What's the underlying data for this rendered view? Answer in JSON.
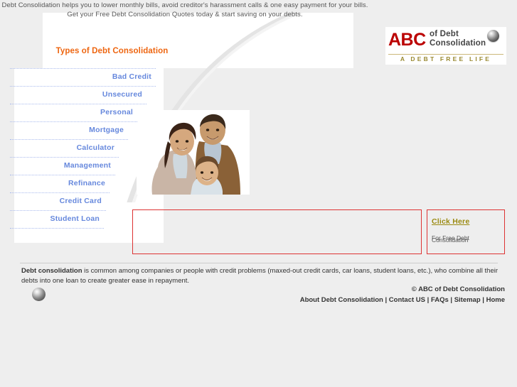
{
  "tagline": {
    "line1": "Debt Consolidation helps you to lower monthly bills, avoid creditor's harassment calls & one easy payment for your bills.",
    "line2": "Get your Free Debt Consolidation Quotes today & start saving on your debts."
  },
  "logo": {
    "abc": "ABC",
    "words_line1": "of Debt",
    "words_line2": "Consolidation",
    "tagline": "A DEBT FREE LIFE",
    "orb_icon": "sphere-orb-icon",
    "colors": {
      "abc_red": "#bb0000",
      "words_gray": "#444444",
      "tagline_olive": "#9a8a33"
    }
  },
  "sidebar": {
    "heading": "Types of Debt Consolidation",
    "heading_color": "#ee6611",
    "link_color": "#6688dd",
    "items": [
      {
        "label": "Bad Credit"
      },
      {
        "label": "Unsecured"
      },
      {
        "label": "Personal"
      },
      {
        "label": "Mortgage"
      },
      {
        "label": "Calculator"
      },
      {
        "label": "Management"
      },
      {
        "label": "Refinance"
      },
      {
        "label": "Credit Card"
      },
      {
        "label": "Student Loan"
      }
    ]
  },
  "hero": {
    "photo_alt": "family-photo"
  },
  "form_box": {
    "border_color": "#dd3333",
    "content": ""
  },
  "promo": {
    "link_label": "Click Here",
    "sub_line1": "For Free Debt",
    "sub_line2": "Consolidation",
    "border_color": "#dd3333",
    "link_color": "#9a8a11"
  },
  "footer": {
    "desc_bold": "Debt consolidation",
    "desc_rest": " is common among companies or people with credit problems (maxed-out credit cards, car loans, student loans, etc.), who combine all their debts into one loan to create greater ease in repayment.",
    "orb_icon": "sphere-orb-icon",
    "copyright": "© ABC of Debt Consolidation",
    "links": [
      {
        "label": "About Debt Consolidation"
      },
      {
        "label": "Contact US"
      },
      {
        "label": "FAQs"
      },
      {
        "label": "Sitemap"
      },
      {
        "label": "Home"
      }
    ],
    "separator": " | "
  }
}
